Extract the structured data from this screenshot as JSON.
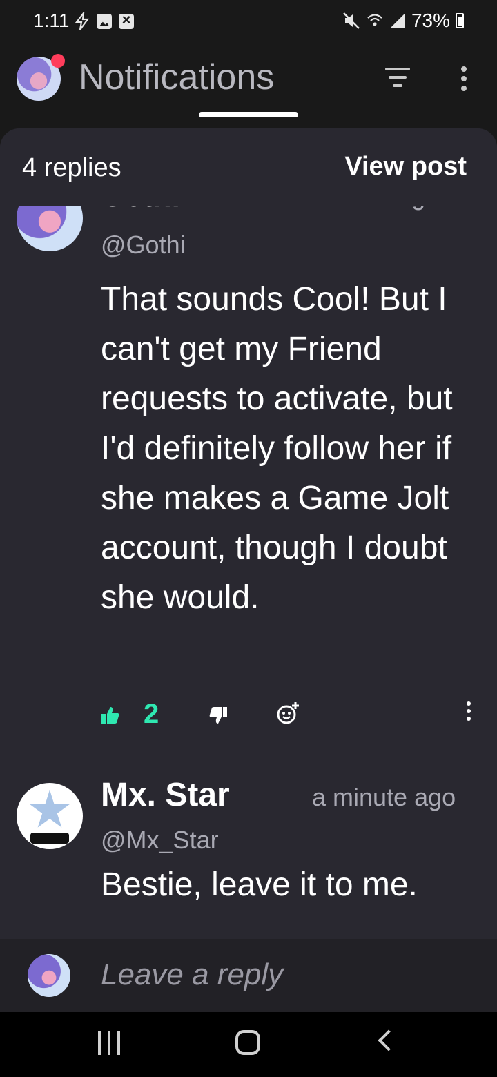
{
  "status_bar": {
    "time": "1:11",
    "battery": "73%"
  },
  "header": {
    "title": "Notifications"
  },
  "sheet": {
    "replies_count": "4 replies",
    "view_post": "View post"
  },
  "comments": [
    {
      "author": "Gothi",
      "author_partial": "Gothi",
      "time_partial": "minutes ago",
      "username": "@Gothi",
      "body": "That sounds Cool! But I can't get my Friend requests to activate, but I'd definitely follow her if she makes a Game Jolt account, though I doubt she would.",
      "likes": "2"
    },
    {
      "author": "Mx. Star",
      "time": "a minute ago",
      "username": "@Mx_Star",
      "body": "Bestie, leave it to me."
    }
  ],
  "reply_bar": {
    "placeholder": "Leave a reply"
  },
  "colors": {
    "accent": "#2fe8b1",
    "sheet_bg": "#292830",
    "notification_dot": "#ff3d5b"
  }
}
